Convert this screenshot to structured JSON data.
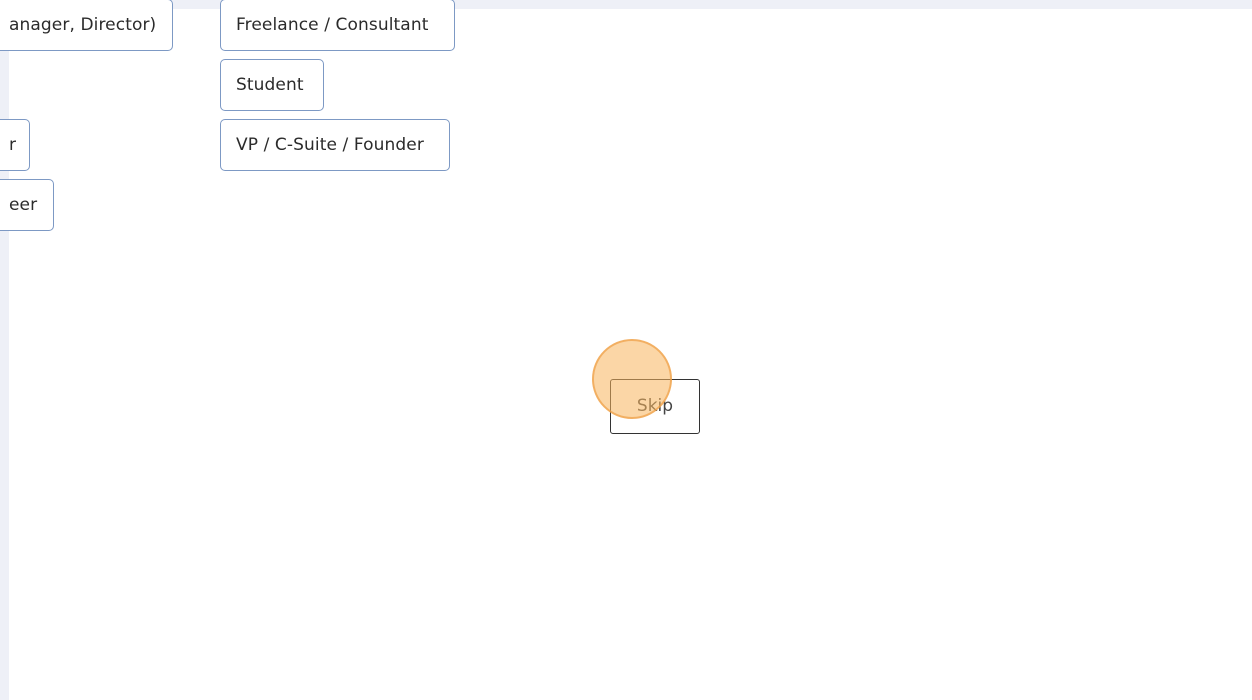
{
  "options_left": [
    {
      "label": "anager, Director)"
    },
    {
      "label": "r"
    },
    {
      "label": "eer"
    }
  ],
  "options_right": [
    {
      "label": "Freelance / Consultant"
    },
    {
      "label": "Student"
    },
    {
      "label": "VP / C-Suite / Founder"
    }
  ],
  "skip": {
    "label": "Skip"
  },
  "colors": {
    "option_border": "#7d99c4",
    "marker_fill": "#f7b55c",
    "band": "#eef0f7"
  }
}
